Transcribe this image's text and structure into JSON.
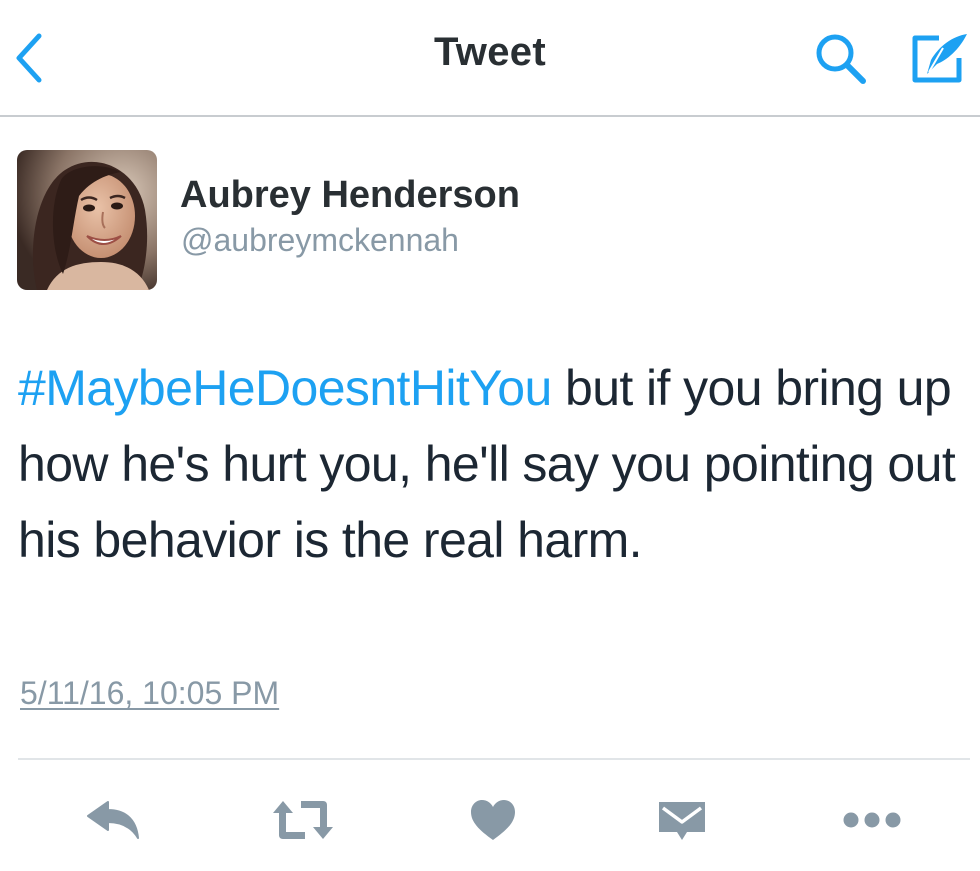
{
  "nav": {
    "title": "Tweet",
    "back_icon": "chevron-left-icon",
    "search_icon": "search-icon",
    "compose_icon": "compose-icon"
  },
  "author": {
    "name": "Aubrey Henderson",
    "handle": "@aubreymckennah",
    "avatar": "profile-photo"
  },
  "tweet": {
    "hashtag": "#MaybeHeDoesntHitYou",
    "text": " but if you bring up how he's hurt you, he'll say you pointing out his behavior is the real harm.",
    "timestamp": "5/11/16, 10:05 PM"
  },
  "actions": [
    {
      "name": "reply",
      "icon": "reply-icon"
    },
    {
      "name": "retweet",
      "icon": "retweet-icon"
    },
    {
      "name": "like",
      "icon": "heart-icon"
    },
    {
      "name": "direct-message",
      "icon": "envelope-icon"
    },
    {
      "name": "more",
      "icon": "more-dots-icon"
    }
  ],
  "colors": {
    "accent": "#1da1f2",
    "text": "#1c2733",
    "secondary": "#8899a6",
    "icon_gray": "#8899a6",
    "divider": "#e1e5e8"
  }
}
